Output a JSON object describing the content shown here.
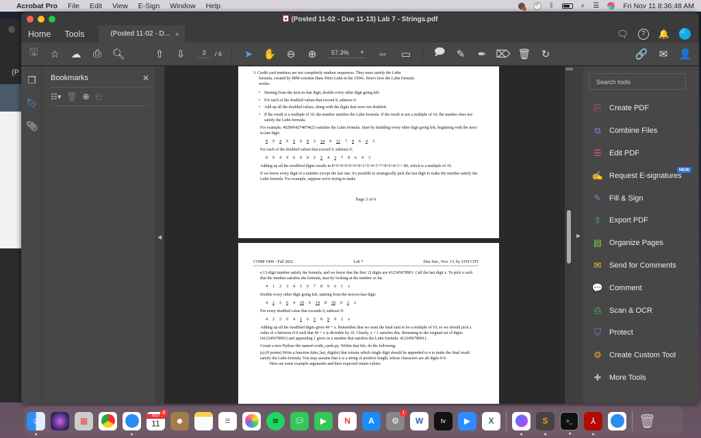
{
  "menubar": {
    "app_name": "Acrobat Pro",
    "items": [
      "File",
      "Edit",
      "View",
      "E-Sign",
      "Window",
      "Help"
    ],
    "clock": "Fri Nov 11  8:36:48 AM"
  },
  "window": {
    "title": "(Posted 11-02 - Due 11-13) Lab 7 - Strings.pdf",
    "background_window_label": "(P"
  },
  "tabs": {
    "home": "Home",
    "tools": "Tools",
    "document_tab": "(Posted 11-02 - D...",
    "close": "×"
  },
  "toolbar": {
    "current_page": "3",
    "total_pages": "/ 6",
    "zoom": "57.3%"
  },
  "bookmarks": {
    "title": "Bookmarks",
    "close": "✕"
  },
  "document": {
    "page3": {
      "item3_line1": "3. Credit card numbers are not completely random sequences. They must satisfy the Luhn",
      "item3_line2": "formula, created by IBM scientist Hans Peter Luhn in the 1950s. Here's how the Luhn formula",
      "item3_line3": "works:",
      "bullets": [
        "Starting from the next-to-last digit, double every other digit going left.",
        "For each of the doubled values that exceed 9, subtract 9.",
        "Add up all the doubled values, along with the digits that were not doubled.",
        "If the result is a multiple of 10, the number satisfies the Luhn formula. If the result is not a multiple of 10, the number does not satisfy the Luhn formula."
      ],
      "example_intro": "For example, 4929004274874623 satisfies the Luhn formula. Start by doubling every other digit going left, beginning with the next-to-last digit:",
      "doubled_digits": [
        {
          "v": "8",
          "u": true
        },
        {
          "v": "9",
          "u": false
        },
        {
          "v": "4",
          "u": true
        },
        {
          "v": "9",
          "u": false
        },
        {
          "v": "0",
          "u": true
        },
        {
          "v": "0",
          "u": false
        },
        {
          "v": "8",
          "u": true
        },
        {
          "v": "2",
          "u": false
        },
        {
          "v": "14",
          "u": true
        },
        {
          "v": "4",
          "u": false
        },
        {
          "v": "12",
          "u": true
        },
        {
          "v": "7",
          "u": false
        },
        {
          "v": "8",
          "u": true
        },
        {
          "v": "6",
          "u": false
        },
        {
          "v": "4",
          "u": true
        },
        {
          "v": "3",
          "u": false
        }
      ],
      "subtract_intro": "For each of the doubled values that exceed 9, subtract 9:",
      "modified_digits": [
        {
          "v": "8",
          "u": false
        },
        {
          "v": "9",
          "u": false
        },
        {
          "v": "4",
          "u": false
        },
        {
          "v": "9",
          "u": false
        },
        {
          "v": "0",
          "u": false
        },
        {
          "v": "0",
          "u": false
        },
        {
          "v": "8",
          "u": false
        },
        {
          "v": "2",
          "u": false
        },
        {
          "v": "5",
          "u": true
        },
        {
          "v": "4",
          "u": false
        },
        {
          "v": "3",
          "u": true
        },
        {
          "v": "7",
          "u": false
        },
        {
          "v": "8",
          "u": false
        },
        {
          "v": "6",
          "u": false
        },
        {
          "v": "4",
          "u": false
        },
        {
          "v": "3",
          "u": false
        }
      ],
      "sum_text": "Adding up all the modified digits results in 8+9+4+9+0+0+8+2+5+4+3+7+8+6+4+3 = 80, which is a multiple of 10.",
      "strategy_text": "If we know every digit of a number except the last one, it's possible to strategically pick the last digit to make the number satisfy the Luhn formula. For example, suppose we're trying to make",
      "footer": "Page 3 of 6"
    },
    "page4": {
      "header_left": "COMP 1900 - Fall 2022",
      "header_center": "Lab 7",
      "header_right": "Due Sun., Nov. 13, by 2359 CDT",
      "intro": "a 13-digit number satisfy the formula, and we know that the first 12 digits are 412345678901. Call the last digit x. To pick x such that the number satisfies the formula, start by looking at the number so far:",
      "digits": [
        {
          "v": "4",
          "u": false
        },
        {
          "v": "1",
          "u": false
        },
        {
          "v": "2",
          "u": false
        },
        {
          "v": "3",
          "u": false
        },
        {
          "v": "4",
          "u": false
        },
        {
          "v": "5",
          "u": false
        },
        {
          "v": "6",
          "u": false
        },
        {
          "v": "7",
          "u": false
        },
        {
          "v": "8",
          "u": false
        },
        {
          "v": "9",
          "u": false
        },
        {
          "v": "0",
          "u": false
        },
        {
          "v": "1",
          "u": false
        },
        {
          "v": "x",
          "u": false
        }
      ],
      "double_intro": "Double every other digit going left, starting from the next-to-last digit:",
      "doubled": [
        {
          "v": "4",
          "u": false
        },
        {
          "v": "2",
          "u": true
        },
        {
          "v": "2",
          "u": false
        },
        {
          "v": "6",
          "u": true
        },
        {
          "v": "4",
          "u": false
        },
        {
          "v": "10",
          "u": true
        },
        {
          "v": "6",
          "u": false
        },
        {
          "v": "14",
          "u": true
        },
        {
          "v": "8",
          "u": false
        },
        {
          "v": "18",
          "u": true
        },
        {
          "v": "0",
          "u": false
        },
        {
          "v": "2",
          "u": true
        },
        {
          "v": "x",
          "u": false
        }
      ],
      "subtract_intro": "For every doubled value that exceeds 9, subtract 9:",
      "modified": [
        {
          "v": "4",
          "u": false
        },
        {
          "v": "2",
          "u": false
        },
        {
          "v": "2",
          "u": false
        },
        {
          "v": "6",
          "u": false
        },
        {
          "v": "4",
          "u": false
        },
        {
          "v": "1",
          "u": true
        },
        {
          "v": "6",
          "u": false
        },
        {
          "v": "5",
          "u": true
        },
        {
          "v": "8",
          "u": false
        },
        {
          "v": "9",
          "u": true
        },
        {
          "v": "0",
          "u": false
        },
        {
          "v": "2",
          "u": false
        },
        {
          "v": "x",
          "u": false
        }
      ],
      "sum_text": "Adding up all the modified digits gives 49 + x. Remember that we want the final sum to be a multiple of 10, so we should pick a value of x between 0-9 such that 49 + x is divisible by 10. Clearly, x = 1 satisfies this. Returning to the original set of digits (412345678901) and appending 1 gives us a number that satisfies the Luhn formula: 4123456789011.",
      "create_text": "Create a new Python file named credit_cards.py. Within that file, do the following:",
      "part_a": "(a) (8 points) Write a function luhn_last_digit(n) that returns which single digit should be appended to n to make the final result satisfy the Luhn formula. You may assume that n is a string of positive length, whose characters are all digits 0-9.",
      "cutoff": "Here are some example arguments and their expected return values:"
    }
  },
  "tools_pane": {
    "search_placeholder": "Search tools",
    "new_badge": "NEW",
    "items": [
      {
        "label": "Create PDF",
        "color": "#e8585f",
        "glyph": "⎘"
      },
      {
        "label": "Combine Files",
        "color": "#8a7cf0",
        "glyph": "⧉"
      },
      {
        "label": "Edit PDF",
        "color": "#e35ca1",
        "glyph": "☰"
      },
      {
        "label": "Request E-signatures",
        "color": "#c95ad8",
        "glyph": "✍"
      },
      {
        "label": "Fill & Sign",
        "color": "#a86ee0",
        "glyph": "✎"
      },
      {
        "label": "Export PDF",
        "color": "#2bb6b6",
        "glyph": "⇪"
      },
      {
        "label": "Organize Pages",
        "color": "#7ad23b",
        "glyph": "▤"
      },
      {
        "label": "Send for Comments",
        "color": "#f2c22b",
        "glyph": "✉"
      },
      {
        "label": "Comment",
        "color": "#f2c22b",
        "glyph": "💬"
      },
      {
        "label": "Scan & OCR",
        "color": "#4fce63",
        "glyph": "⎙"
      },
      {
        "label": "Protect",
        "color": "#8f8df0",
        "glyph": "⛉"
      },
      {
        "label": "Create Custom Tool",
        "color": "#f2a33b",
        "glyph": "⚙"
      },
      {
        "label": "More Tools",
        "color": "#bbbbbb",
        "glyph": "✚"
      }
    ]
  },
  "dock": {
    "calendar_month": "NOV",
    "calendar_day": "11",
    "calendar_badge": "8",
    "settings_badge": "1"
  }
}
